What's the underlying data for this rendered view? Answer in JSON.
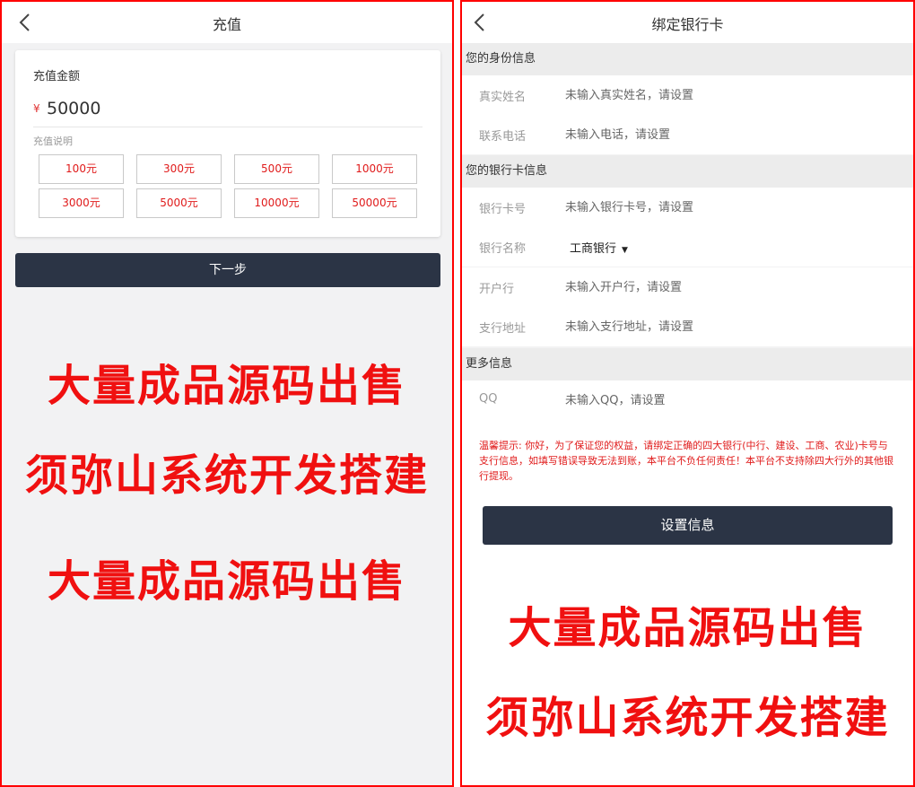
{
  "recharge": {
    "title": "充值",
    "amount_label": "充值金额",
    "currency_symbol": "¥",
    "amount_value": "50000",
    "note_label": "充值说明",
    "options": [
      "100元",
      "300元",
      "500元",
      "1000元",
      "3000元",
      "5000元",
      "10000元",
      "50000元"
    ],
    "next_label": "下一步",
    "promo_lines": [
      "大量成品源码出售",
      "须弥山系统开发搭建",
      "大量成品源码出售"
    ]
  },
  "bind_card": {
    "title": "绑定银行卡",
    "identity_header": "您的身份信息",
    "name_label": "真实姓名",
    "name_placeholder": "未输入真实姓名，请设置",
    "phone_label": "联系电话",
    "phone_placeholder": "未输入电话，请设置",
    "card_header": "您的银行卡信息",
    "card_no_label": "银行卡号",
    "card_no_placeholder": "未输入银行卡号，请设置",
    "bank_name_label": "银行名称",
    "bank_name_value": "工商银行",
    "branch_label": "开户行",
    "branch_placeholder": "未输入开户行，请设置",
    "address_label": "支行地址",
    "address_placeholder": "未输入支行地址，请设置",
    "more_header": "更多信息",
    "qq_label": "QQ",
    "qq_placeholder": "未输入QQ，请设置",
    "notice": "温馨提示: 你好，为了保证您的权益，请绑定正确的四大银行(中行、建设、工商、农业)卡号与支行信息，如填写错误导致无法到账，本平台不负任何责任！本平台不支持除四大行外的其他银行提现。",
    "submit_label": "设置信息",
    "promo_lines": [
      "大量成品源码出售",
      "须弥山系统开发搭建"
    ]
  },
  "colors": {
    "frame_border": "#ff0000",
    "promo_text": "#f01010",
    "button_bg": "#2b3445",
    "option_text": "#e01b1b",
    "page_bg": "#f2f2f3"
  }
}
